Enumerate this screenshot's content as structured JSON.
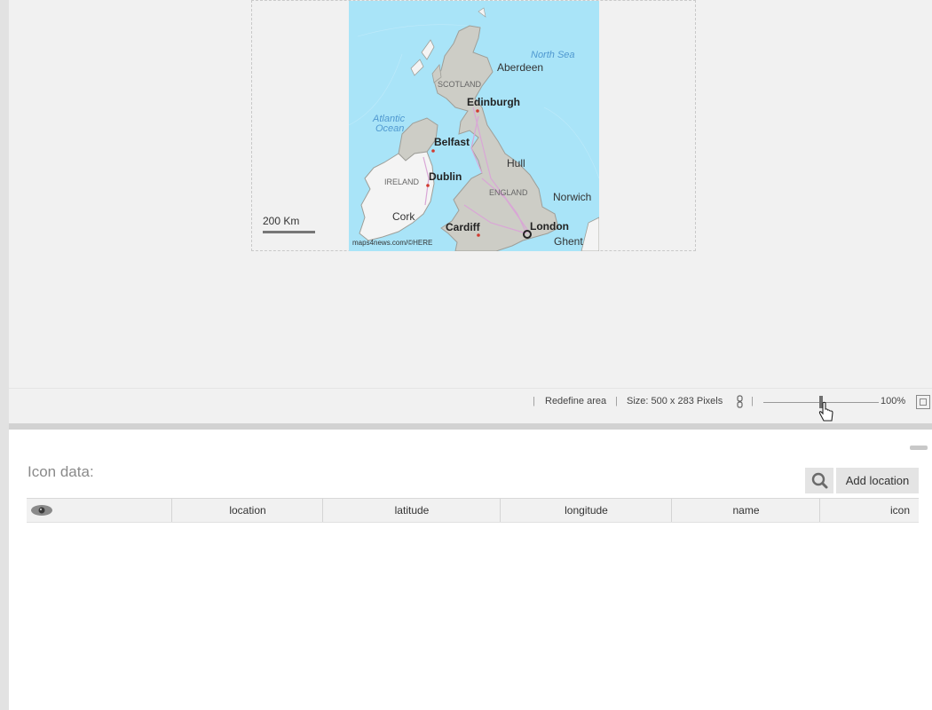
{
  "map": {
    "attribution": "maps4news.com/©HERE",
    "scale_label": "200 Km",
    "labels": {
      "north_sea": "North Sea",
      "atlantic": "Atlantic",
      "ocean": "Ocean",
      "scotland": "SCOTLAND",
      "aberdeen": "Aberdeen",
      "edinburgh": "Edinburgh",
      "belfast": "Belfast",
      "dublin": "Dublin",
      "ireland": "IRELAND",
      "hull": "Hull",
      "england": "ENGLAND",
      "norwich": "Norwich",
      "cork": "Cork",
      "cardiff": "Cardiff",
      "london": "London",
      "ghent": "Ghent"
    },
    "colors": {
      "sea": "#a9e4f8",
      "land": "#cdcdc6",
      "ireland_land": "#f4f4f4",
      "roads": "#d9a6d6"
    }
  },
  "statusbar": {
    "redefine_area": "Redefine area",
    "size": "Size: 500 x 283 Pixels",
    "zoom": "100%"
  },
  "panel": {
    "title": "Icon data:",
    "add_location": "Add location",
    "columns": [
      "location",
      "latitude",
      "longitude",
      "name",
      "icon"
    ]
  }
}
